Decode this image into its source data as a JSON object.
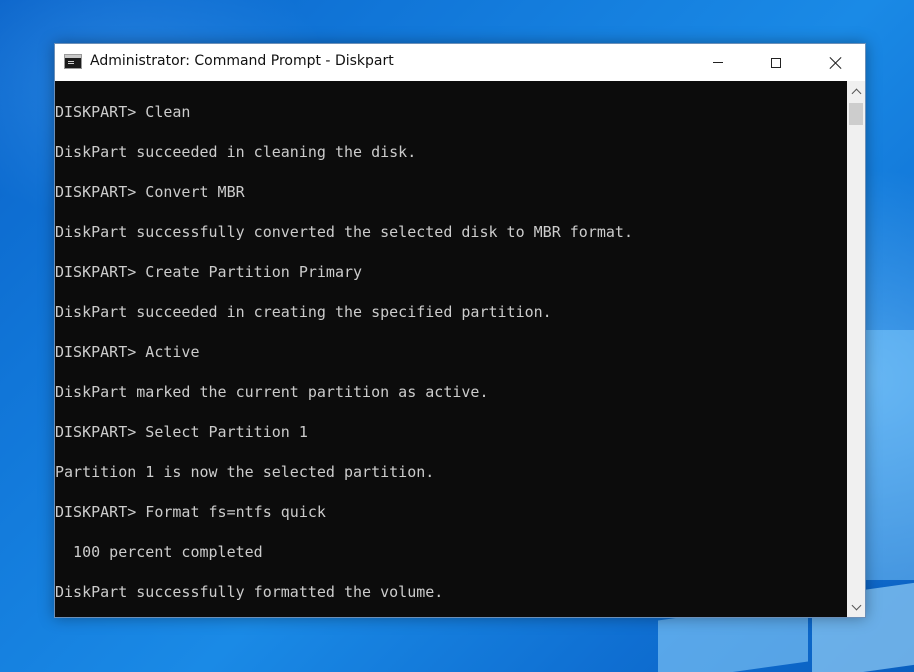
{
  "window": {
    "title": "Administrator: Command Prompt - Diskpart"
  },
  "console": {
    "lines": [
      "DISKPART> Clean",
      "DiskPart succeeded in cleaning the disk.",
      "DISKPART> Convert MBR",
      "DiskPart successfully converted the selected disk to MBR format.",
      "DISKPART> Create Partition Primary",
      "DiskPart succeeded in creating the specified partition.",
      "DISKPART> Active",
      "DiskPart marked the current partition as active.",
      "DISKPART> Select Partition 1",
      "Partition 1 is now the selected partition.",
      "DISKPART> Format fs=ntfs quick",
      "  100 percent completed",
      "DiskPart successfully formatted the volume."
    ]
  },
  "icons": {
    "app": "command-prompt-icon",
    "minimize": "minimize-icon",
    "maximize": "maximize-icon",
    "close": "close-icon",
    "scroll_up": "chevron-up-icon",
    "scroll_down": "chevron-down-icon"
  },
  "colors": {
    "console_background": "#0c0c0c",
    "console_text": "#cccccc",
    "titlebar": "#ffffff",
    "desktop_accent": "#0a63c9"
  }
}
